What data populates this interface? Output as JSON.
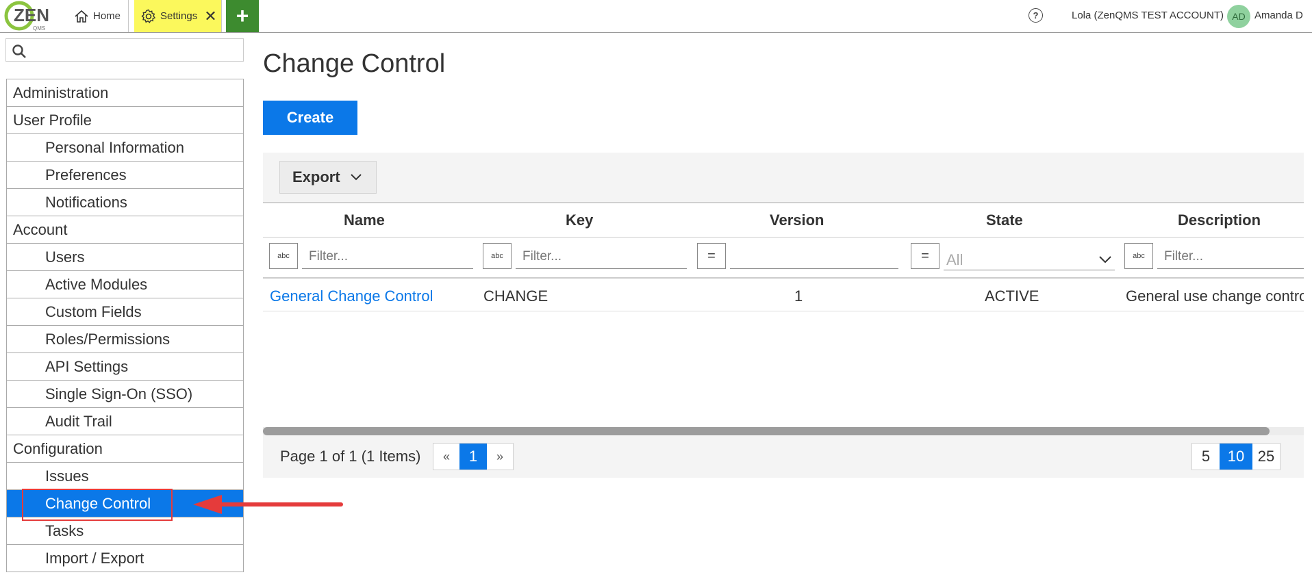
{
  "topbar": {
    "logo_text": "ZEN",
    "logo_sub": "QMS",
    "tabs": [
      {
        "label": "Home",
        "icon": "home-icon"
      },
      {
        "label": "Settings",
        "icon": "gear-icon",
        "close": "✕"
      }
    ],
    "add_label": "+",
    "help_label": "?",
    "account": "Lola (ZenQMS TEST ACCOUNT)",
    "avatar_initials": "AD",
    "user_name": "Amanda D"
  },
  "sidebar": {
    "search_placeholder": "",
    "items": [
      {
        "label": "Administration",
        "level": "group"
      },
      {
        "label": "User Profile",
        "level": "group"
      },
      {
        "label": "Personal Information",
        "level": "child"
      },
      {
        "label": "Preferences",
        "level": "child"
      },
      {
        "label": "Notifications",
        "level": "child"
      },
      {
        "label": "Account",
        "level": "group"
      },
      {
        "label": "Users",
        "level": "child"
      },
      {
        "label": "Active Modules",
        "level": "child"
      },
      {
        "label": "Custom Fields",
        "level": "child"
      },
      {
        "label": "Roles/Permissions",
        "level": "child"
      },
      {
        "label": "API Settings",
        "level": "child"
      },
      {
        "label": "Single Sign-On (SSO)",
        "level": "child"
      },
      {
        "label": "Audit Trail",
        "level": "child"
      },
      {
        "label": "Configuration",
        "level": "group"
      },
      {
        "label": "Issues",
        "level": "child"
      },
      {
        "label": "Change Control",
        "level": "child",
        "active": true
      },
      {
        "label": "Tasks",
        "level": "child"
      },
      {
        "label": "Import / Export",
        "level": "child"
      }
    ]
  },
  "main": {
    "title": "Change Control",
    "create_label": "Create",
    "export_label": "Export",
    "columns": [
      "Name",
      "Key",
      "Version",
      "State",
      "Description"
    ],
    "filters": {
      "text_placeholder": "Filter...",
      "text_icon": "abc",
      "eq_icon": "=",
      "state_value": "All"
    },
    "rows": [
      {
        "name": "General Change Control",
        "key": "CHANGE",
        "version": "1",
        "state": "ACTIVE",
        "description": "General use change control"
      }
    ],
    "pager": {
      "info": "Page 1 of 1 (1 Items)",
      "prev": "«",
      "current": "1",
      "next": "»",
      "sizes": [
        "5",
        "10",
        "25"
      ],
      "current_size": "10"
    }
  },
  "colors": {
    "accent": "#0b78e8",
    "settings_tab": "#fbf85c",
    "add_tab": "#3d8b2f",
    "annotation": "#e53b3b"
  }
}
